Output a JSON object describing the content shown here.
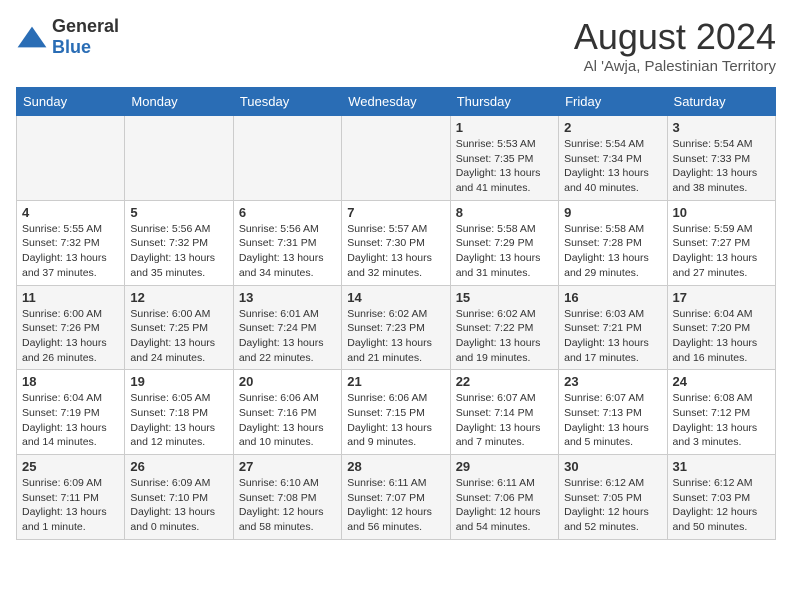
{
  "logo": {
    "text_general": "General",
    "text_blue": "Blue",
    "icon_shape": "triangle"
  },
  "header": {
    "month_year": "August 2024",
    "location": "Al 'Awja, Palestinian Territory"
  },
  "weekdays": [
    "Sunday",
    "Monday",
    "Tuesday",
    "Wednesday",
    "Thursday",
    "Friday",
    "Saturday"
  ],
  "weeks": [
    [
      {
        "day": "",
        "sunrise": "",
        "sunset": "",
        "daylight": ""
      },
      {
        "day": "",
        "sunrise": "",
        "sunset": "",
        "daylight": ""
      },
      {
        "day": "",
        "sunrise": "",
        "sunset": "",
        "daylight": ""
      },
      {
        "day": "",
        "sunrise": "",
        "sunset": "",
        "daylight": ""
      },
      {
        "day": "1",
        "sunrise": "Sunrise: 5:53 AM",
        "sunset": "Sunset: 7:35 PM",
        "daylight": "Daylight: 13 hours and 41 minutes."
      },
      {
        "day": "2",
        "sunrise": "Sunrise: 5:54 AM",
        "sunset": "Sunset: 7:34 PM",
        "daylight": "Daylight: 13 hours and 40 minutes."
      },
      {
        "day": "3",
        "sunrise": "Sunrise: 5:54 AM",
        "sunset": "Sunset: 7:33 PM",
        "daylight": "Daylight: 13 hours and 38 minutes."
      }
    ],
    [
      {
        "day": "4",
        "sunrise": "Sunrise: 5:55 AM",
        "sunset": "Sunset: 7:32 PM",
        "daylight": "Daylight: 13 hours and 37 minutes."
      },
      {
        "day": "5",
        "sunrise": "Sunrise: 5:56 AM",
        "sunset": "Sunset: 7:32 PM",
        "daylight": "Daylight: 13 hours and 35 minutes."
      },
      {
        "day": "6",
        "sunrise": "Sunrise: 5:56 AM",
        "sunset": "Sunset: 7:31 PM",
        "daylight": "Daylight: 13 hours and 34 minutes."
      },
      {
        "day": "7",
        "sunrise": "Sunrise: 5:57 AM",
        "sunset": "Sunset: 7:30 PM",
        "daylight": "Daylight: 13 hours and 32 minutes."
      },
      {
        "day": "8",
        "sunrise": "Sunrise: 5:58 AM",
        "sunset": "Sunset: 7:29 PM",
        "daylight": "Daylight: 13 hours and 31 minutes."
      },
      {
        "day": "9",
        "sunrise": "Sunrise: 5:58 AM",
        "sunset": "Sunset: 7:28 PM",
        "daylight": "Daylight: 13 hours and 29 minutes."
      },
      {
        "day": "10",
        "sunrise": "Sunrise: 5:59 AM",
        "sunset": "Sunset: 7:27 PM",
        "daylight": "Daylight: 13 hours and 27 minutes."
      }
    ],
    [
      {
        "day": "11",
        "sunrise": "Sunrise: 6:00 AM",
        "sunset": "Sunset: 7:26 PM",
        "daylight": "Daylight: 13 hours and 26 minutes."
      },
      {
        "day": "12",
        "sunrise": "Sunrise: 6:00 AM",
        "sunset": "Sunset: 7:25 PM",
        "daylight": "Daylight: 13 hours and 24 minutes."
      },
      {
        "day": "13",
        "sunrise": "Sunrise: 6:01 AM",
        "sunset": "Sunset: 7:24 PM",
        "daylight": "Daylight: 13 hours and 22 minutes."
      },
      {
        "day": "14",
        "sunrise": "Sunrise: 6:02 AM",
        "sunset": "Sunset: 7:23 PM",
        "daylight": "Daylight: 13 hours and 21 minutes."
      },
      {
        "day": "15",
        "sunrise": "Sunrise: 6:02 AM",
        "sunset": "Sunset: 7:22 PM",
        "daylight": "Daylight: 13 hours and 19 minutes."
      },
      {
        "day": "16",
        "sunrise": "Sunrise: 6:03 AM",
        "sunset": "Sunset: 7:21 PM",
        "daylight": "Daylight: 13 hours and 17 minutes."
      },
      {
        "day": "17",
        "sunrise": "Sunrise: 6:04 AM",
        "sunset": "Sunset: 7:20 PM",
        "daylight": "Daylight: 13 hours and 16 minutes."
      }
    ],
    [
      {
        "day": "18",
        "sunrise": "Sunrise: 6:04 AM",
        "sunset": "Sunset: 7:19 PM",
        "daylight": "Daylight: 13 hours and 14 minutes."
      },
      {
        "day": "19",
        "sunrise": "Sunrise: 6:05 AM",
        "sunset": "Sunset: 7:18 PM",
        "daylight": "Daylight: 13 hours and 12 minutes."
      },
      {
        "day": "20",
        "sunrise": "Sunrise: 6:06 AM",
        "sunset": "Sunset: 7:16 PM",
        "daylight": "Daylight: 13 hours and 10 minutes."
      },
      {
        "day": "21",
        "sunrise": "Sunrise: 6:06 AM",
        "sunset": "Sunset: 7:15 PM",
        "daylight": "Daylight: 13 hours and 9 minutes."
      },
      {
        "day": "22",
        "sunrise": "Sunrise: 6:07 AM",
        "sunset": "Sunset: 7:14 PM",
        "daylight": "Daylight: 13 hours and 7 minutes."
      },
      {
        "day": "23",
        "sunrise": "Sunrise: 6:07 AM",
        "sunset": "Sunset: 7:13 PM",
        "daylight": "Daylight: 13 hours and 5 minutes."
      },
      {
        "day": "24",
        "sunrise": "Sunrise: 6:08 AM",
        "sunset": "Sunset: 7:12 PM",
        "daylight": "Daylight: 13 hours and 3 minutes."
      }
    ],
    [
      {
        "day": "25",
        "sunrise": "Sunrise: 6:09 AM",
        "sunset": "Sunset: 7:11 PM",
        "daylight": "Daylight: 13 hours and 1 minute."
      },
      {
        "day": "26",
        "sunrise": "Sunrise: 6:09 AM",
        "sunset": "Sunset: 7:10 PM",
        "daylight": "Daylight: 13 hours and 0 minutes."
      },
      {
        "day": "27",
        "sunrise": "Sunrise: 6:10 AM",
        "sunset": "Sunset: 7:08 PM",
        "daylight": "Daylight: 12 hours and 58 minutes."
      },
      {
        "day": "28",
        "sunrise": "Sunrise: 6:11 AM",
        "sunset": "Sunset: 7:07 PM",
        "daylight": "Daylight: 12 hours and 56 minutes."
      },
      {
        "day": "29",
        "sunrise": "Sunrise: 6:11 AM",
        "sunset": "Sunset: 7:06 PM",
        "daylight": "Daylight: 12 hours and 54 minutes."
      },
      {
        "day": "30",
        "sunrise": "Sunrise: 6:12 AM",
        "sunset": "Sunset: 7:05 PM",
        "daylight": "Daylight: 12 hours and 52 minutes."
      },
      {
        "day": "31",
        "sunrise": "Sunrise: 6:12 AM",
        "sunset": "Sunset: 7:03 PM",
        "daylight": "Daylight: 12 hours and 50 minutes."
      }
    ]
  ]
}
